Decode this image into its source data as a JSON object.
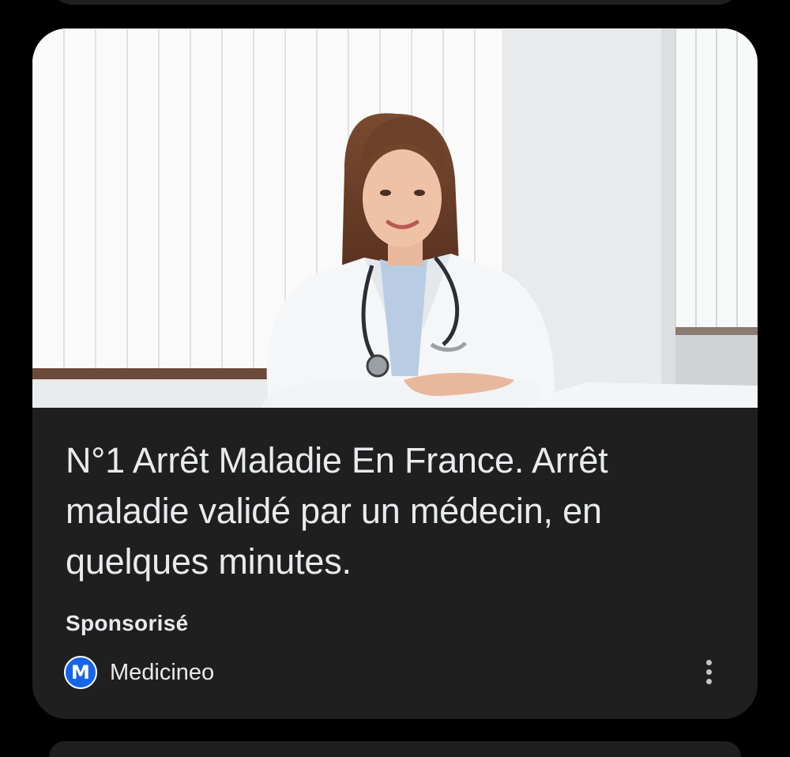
{
  "ad": {
    "image_alt": "Femme médecin souriante en blouse blanche avec un stéthoscope, assise à un bureau",
    "headline": "N°1 Arrêt Maladie En France. Arrêt maladie validé par un médecin, en quelques minutes.",
    "sponsored_label": "Sponsorisé",
    "advertiser": {
      "name": "Medicineo",
      "logo_letter": "M",
      "logo_color": "#1565e8"
    },
    "more_icon": "more-vert-icon"
  },
  "colors": {
    "background": "#000000",
    "card": "#1f1f1f",
    "text": "#e8eaed"
  }
}
